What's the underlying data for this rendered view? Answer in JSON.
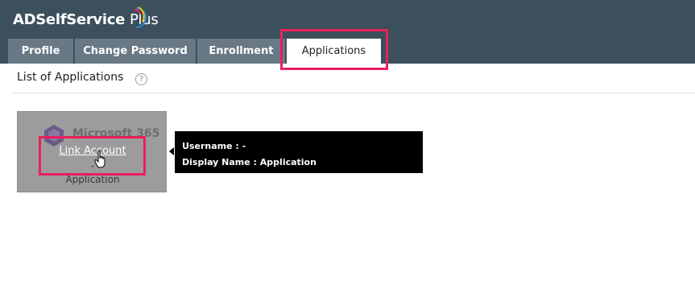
{
  "header": {
    "logo_main": "ADSelfService",
    "logo_plus": "Plus",
    "logo_arc_colors": [
      "#e8205c",
      "#f6c40e",
      "#1f8ad6"
    ],
    "background": "#3c4f5c"
  },
  "tabs": [
    {
      "label": "Profile",
      "active": false
    },
    {
      "label": "Change Password",
      "active": false
    },
    {
      "label": "Enrollment",
      "active": false
    },
    {
      "label": "Applications",
      "active": true
    }
  ],
  "page": {
    "title": "List of Applications",
    "help_icon": "question-circle-icon"
  },
  "app_card": {
    "brand": "Microsoft 365",
    "logo_icon": "microsoft-365-icon",
    "link_label": "Link Account",
    "dash": "-",
    "name": "Application"
  },
  "tooltip": {
    "username_label": "Username : -",
    "display_name_label": "Display Name : Application"
  },
  "cursor": "hand-pointer-icon",
  "highlight_color": "#e8205c"
}
